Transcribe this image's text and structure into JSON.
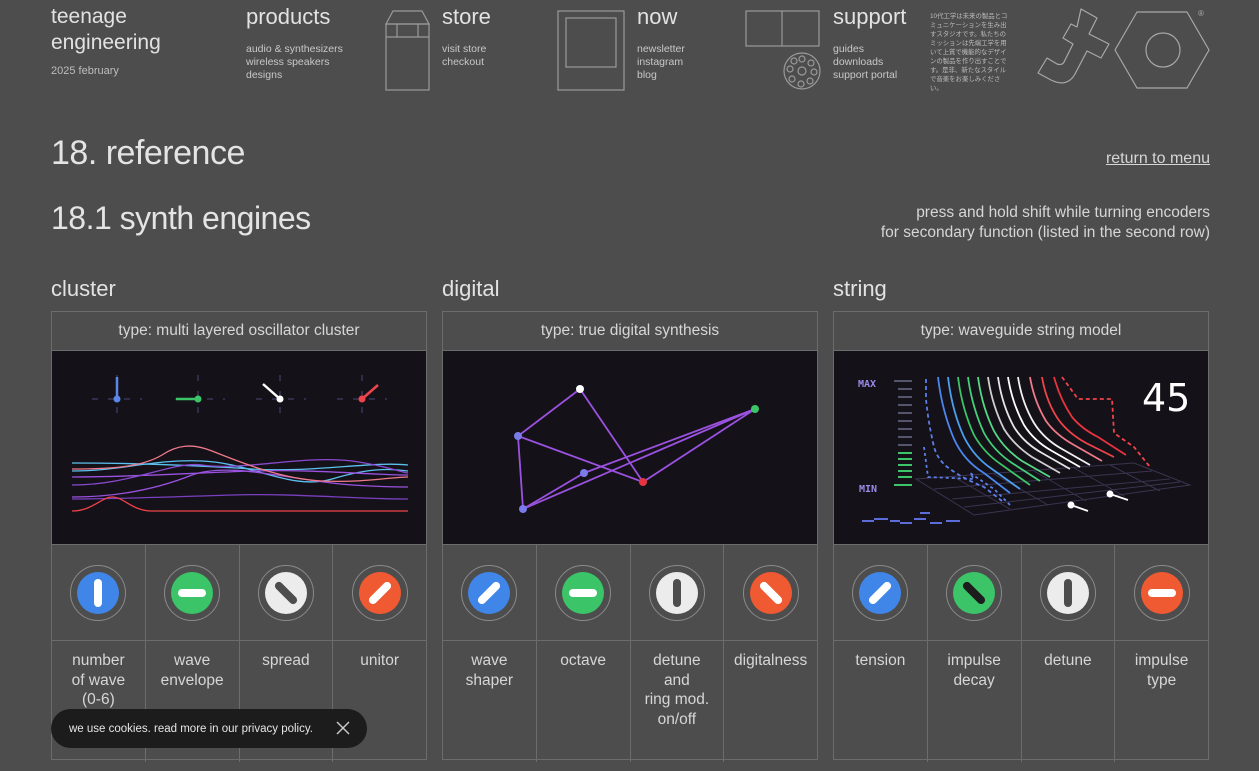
{
  "header": {
    "brand": {
      "line1": "teenage",
      "line2": "engineering",
      "date": "2025 february"
    },
    "products": {
      "title": "products",
      "links": [
        "audio & synthesizers",
        "wireless speakers",
        "designs"
      ]
    },
    "store": {
      "title": "store",
      "links": [
        "visit store",
        "checkout"
      ]
    },
    "now": {
      "title": "now",
      "links": [
        "newsletter",
        "instagram",
        "blog"
      ]
    },
    "support": {
      "title": "support",
      "links": [
        "guides",
        "downloads",
        "support portal"
      ]
    },
    "japanese": "10代工学は未来の製品とコミュニケーションを生み出すスタジオです。私たちのミッションは先端工学を用いて上質で機能的なデザインの製品を作り出すことです。是非、新たなスタイルで音楽をお楽しみください。",
    "logo_mark": "®"
  },
  "page": {
    "title": "18. reference",
    "return_link": "return to menu",
    "section_title": "18.1 synth engines",
    "hint_line1": "press and hold shift while turning encoders",
    "hint_line2": "for secondary function (listed in the second row)"
  },
  "engines": [
    {
      "name": "cluster",
      "type": "type: multi layered oscillator cluster",
      "knobs": [
        {
          "label_lines": [
            "number",
            "of wave",
            "(0-6)"
          ],
          "color": "#3f86e8",
          "angle": 0,
          "icon": "blue-knob-icon"
        },
        {
          "label_lines": [
            "wave",
            "envelope"
          ],
          "color": "#3cc468",
          "angle": 90,
          "icon": "green-knob-icon"
        },
        {
          "label_lines": [
            "spread"
          ],
          "color": "#ececec",
          "angle": -45,
          "icon": "white-knob-icon"
        },
        {
          "label_lines": [
            "unitor"
          ],
          "color": "#f05a32",
          "angle": 45,
          "icon": "orange-knob-icon"
        }
      ]
    },
    {
      "name": "digital",
      "type": "type: true digital synthesis",
      "knobs": [
        {
          "label_lines": [
            "wave",
            "shaper"
          ],
          "color": "#3f86e8",
          "angle": 45,
          "icon": "blue-knob-icon"
        },
        {
          "label_lines": [
            "octave"
          ],
          "color": "#3cc468",
          "angle": 90,
          "icon": "green-knob-icon"
        },
        {
          "label_lines": [
            "detune",
            "and",
            "ring mod.",
            "on/off"
          ],
          "color": "#ececec",
          "angle": 0,
          "icon": "white-knob-icon"
        },
        {
          "label_lines": [
            "digitalness"
          ],
          "color": "#f05a32",
          "angle": -45,
          "icon": "orange-knob-icon"
        }
      ]
    },
    {
      "name": "string",
      "type": "type: waveguide string model",
      "knobs": [
        {
          "label_lines": [
            "tension"
          ],
          "color": "#3f86e8",
          "angle": 45,
          "icon": "blue-knob-icon"
        },
        {
          "label_lines": [
            "impulse",
            "decay"
          ],
          "color": "#3cc468",
          "angle": -45,
          "icon": "green-knob-icon"
        },
        {
          "label_lines": [
            "detune"
          ],
          "color": "#ececec",
          "angle": 0,
          "icon": "white-knob-icon"
        },
        {
          "label_lines": [
            "impulse",
            "type"
          ],
          "color": "#f05a32",
          "angle": 90,
          "icon": "orange-knob-icon"
        }
      ]
    }
  ],
  "string_display": {
    "max_label": "MAX",
    "min_label": "MIN",
    "value": "45"
  },
  "cookie": {
    "text": "we use cookies. read more in our privacy policy."
  },
  "colors": {
    "background": "#4d4d4d",
    "screen": "#141118",
    "blue": "#3f86e8",
    "green": "#3cc468",
    "orange": "#f05a32",
    "purple": "#9b52e0",
    "red": "#e8343e"
  }
}
